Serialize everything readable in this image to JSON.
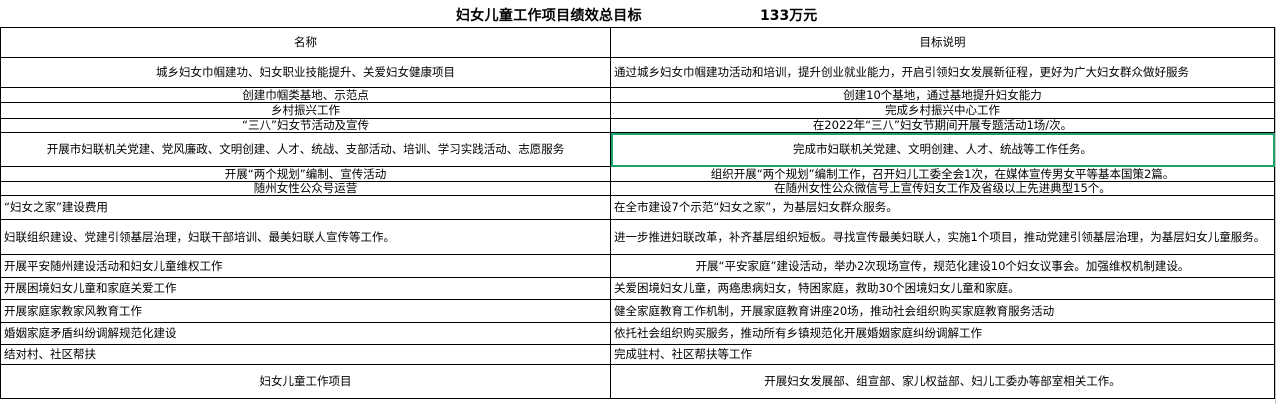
{
  "header": {
    "title": "妇女儿童工作项目绩效总目标",
    "amount": "133万元"
  },
  "columns": [
    "名称",
    "目标说明"
  ],
  "rows": [
    {
      "name": "城乡妇女巾帼建功、妇女职业技能提升、关爱妇女健康项目",
      "desc": "通过城乡妇女巾帼建功活动和培训，提升创业就业能力，开启引领妇女发展新征程，更好为广大妇女群众做好服务"
    },
    {
      "name": "创建巾帼类基地、示范点",
      "desc": "创建10个基地，通过基地提升妇女能力"
    },
    {
      "name": "乡村振兴工作",
      "desc": "完成乡村振兴中心工作"
    },
    {
      "name": "“三八”妇女节活动及宣传",
      "desc": "在2022年“三八”妇女节期间开展专题活动1场/次。"
    },
    {
      "name": "开展市妇联机关党建、党风廉政、文明创建、人才、统战、支部活动、培训、学习实践活动、志愿服务",
      "desc": "完成市妇联机关党建、文明创建、人才、统战等工作任务。"
    },
    {
      "name": "开展“两个规划”编制、宣传活动",
      "desc": "组织开展“两个规划”编制工作，召开妇儿工委全会1次，在媒体宣传男女平等基本国策2篇。"
    },
    {
      "name": "随州女性公众号运营",
      "desc": "在随州女性公众微信号上宣传妇女工作及省级以上先进典型15个。"
    },
    {
      "name": "“妇女之家”建设费用",
      "desc": "在全市建设7个示范“妇女之家”，为基层妇女群众服务。"
    },
    {
      "name": "妇联组织建设、党建引领基层治理，妇联干部培训、最美妇联人宣传等工作。",
      "desc": "进一步推进妇联改革，补齐基层组织短板。寻找宣传最美妇联人，实施1个项目，推动党建引领基层治理，为基层妇女儿童服务。"
    },
    {
      "name": "开展平安随州建设活动和妇女儿童维权工作",
      "desc": "开展“平安家庭”建设活动，举办2次现场宣传，规范化建设10个妇女议事会。加强维权机制建设。"
    },
    {
      "name": "开展困境妇女儿童和家庭关爱工作",
      "desc": "关爱困境妇女儿童，两癌患病妇女，特困家庭，救助30个困境妇女儿童和家庭。"
    },
    {
      "name": "开展家庭家教家风教育工作",
      "desc": "健全家庭教育工作机制，开展家庭教育讲座20场，推动社会组织购买家庭教育服务活动"
    },
    {
      "name": "婚姻家庭矛盾纠纷调解规范化建设",
      "desc": "依托社会组织购买服务，推动所有乡镇规范化开展婚姻家庭纠纷调解工作"
    },
    {
      "name": "结对村、社区帮扶",
      "desc": "完成驻村、社区帮扶等工作"
    },
    {
      "name": "妇女儿童工作项目",
      "desc": "开展妇女发展部、组宣部、家儿权益部、妇儿工委办等部室相关工作。"
    }
  ]
}
